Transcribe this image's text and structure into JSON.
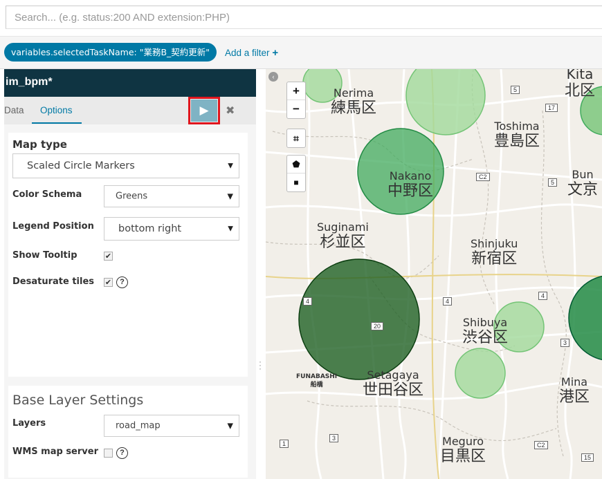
{
  "search": {
    "placeholder": "Search... (e.g. status:200 AND extension:PHP)"
  },
  "filters": {
    "pill_text": "variables.selectedTaskName: \"業務B_契約更新\"",
    "add_filter_label": "Add a filter",
    "add_filter_plus": "+"
  },
  "panel": {
    "title": "im_bpm*",
    "tabs": {
      "data": "Data",
      "options": "Options"
    },
    "apply_icon": "▶",
    "discard_icon": "✖"
  },
  "options": {
    "map_type_label": "Map type",
    "map_type_value": "Scaled Circle Markers",
    "color_schema_label": "Color Schema",
    "color_schema_value": "Greens",
    "legend_position_label": "Legend Position",
    "legend_position_value": "bottom right",
    "show_tooltip_label": "Show Tooltip",
    "show_tooltip_checked": "✔",
    "desaturate_label": "Desaturate tiles",
    "desaturate_checked": "✔",
    "help_icon": "?"
  },
  "base_layer": {
    "title": "Base Layer Settings",
    "layers_label": "Layers",
    "layers_value": "road_map",
    "wms_label": "WMS map server"
  },
  "map": {
    "zoom_in": "+",
    "zoom_out": "−",
    "crop_icon": "⌗",
    "polygon_icon": "⬟",
    "rectangle_icon": "■",
    "collapse_icon": "‹",
    "places": {
      "nerima": "Nerima",
      "nerima_jp": "練馬区",
      "toshima": "Toshima",
      "toshima_jp": "豊島区",
      "nakano": "Nakano",
      "nakano_jp": "中野区",
      "bunkyo": "Bun",
      "bunkyo_jp": "文京",
      "suginami": "Suginami",
      "suginami_jp": "杉並区",
      "shinjuku": "Shinjuku",
      "shinjuku_jp": "新宿区",
      "shibuya": "Shibuya",
      "shibuya_jp": "渋谷区",
      "setagaya": "Setagaya",
      "setagaya_jp": "世田谷区",
      "minato": "Mina",
      "minato_jp": "港区",
      "meguro": "Meguro",
      "meguro_jp": "目黒区",
      "kita": "Kita",
      "kita_jp": "北区",
      "funabashi": "FUNABASHI",
      "funabashi_jp": "船橋"
    },
    "road_signs": [
      "5",
      "17",
      "C2",
      "5",
      "4",
      "4",
      "20",
      "3",
      "3",
      "C2",
      "15",
      "1",
      "4"
    ]
  },
  "colors": {
    "accent": "#0079a5",
    "title_bar": "#0f3442",
    "apply_highlight": "#e0161e",
    "circle_light": "#a1d99b",
    "circle_mid": "#41ab5d",
    "circle_dark": "#1b5e20"
  }
}
